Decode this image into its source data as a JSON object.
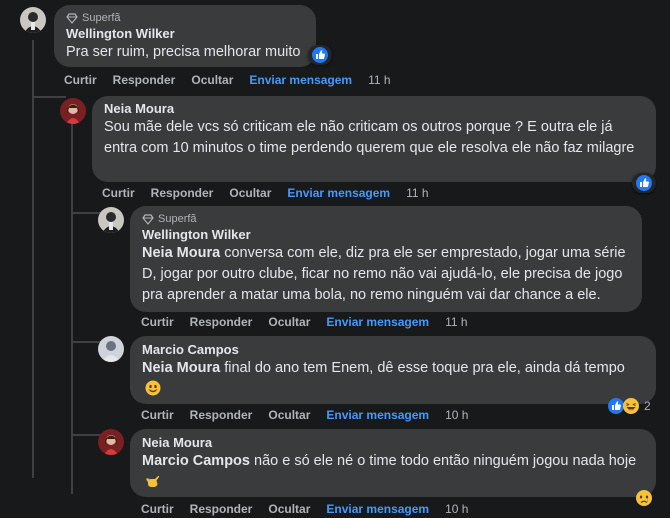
{
  "actions": {
    "like": "Curtir",
    "reply": "Responder",
    "hide": "Ocultar",
    "message": "Enviar mensagem"
  },
  "comments": [
    {
      "badge": "Superfã",
      "author": "Wellington Wilker",
      "text": "Pra ser ruim, precisa melhorar muito",
      "time": "11 h",
      "reaction": "like"
    },
    {
      "author": "Neia Moura",
      "text": "Sou mãe dele vcs só criticam ele não criticam os outros porque ? E outra ele já entra com 10 minutos o time perdendo querem que ele resolva ele não faz milagre",
      "time": "11 h",
      "reaction": "like"
    },
    {
      "badge": "Superfã",
      "author": "Wellington Wilker",
      "mention": "Neia Moura",
      "text": "conversa com ele, diz pra ele ser emprestado, jogar uma série D, jogar por outro clube, ficar no remo não vai ajudá-lo, ele precisa de jogo pra aprender a matar uma bola, no remo ninguém vai dar chance a ele.",
      "time": "11 h"
    },
    {
      "author": "Marcio Campos",
      "mention": "Neia Moura",
      "text": "final do ano tem Enem, dê esse toque pra ele, ainda dá tempo",
      "emoji": "smile",
      "time": "10 h",
      "reaction": "like+haha",
      "reaction_count": "2"
    },
    {
      "author": "Neia Moura",
      "mention": "Marcio Campos",
      "text": "não e só ele né o time todo então ninguém jogou nada hoje",
      "emoji": "call-me-hand",
      "time": "10 h",
      "reaction": "sad"
    }
  ],
  "colors": {
    "background": "#18191a",
    "bubble": "#3a3b3c",
    "link": "#4599ff",
    "like": "#2078f4"
  }
}
